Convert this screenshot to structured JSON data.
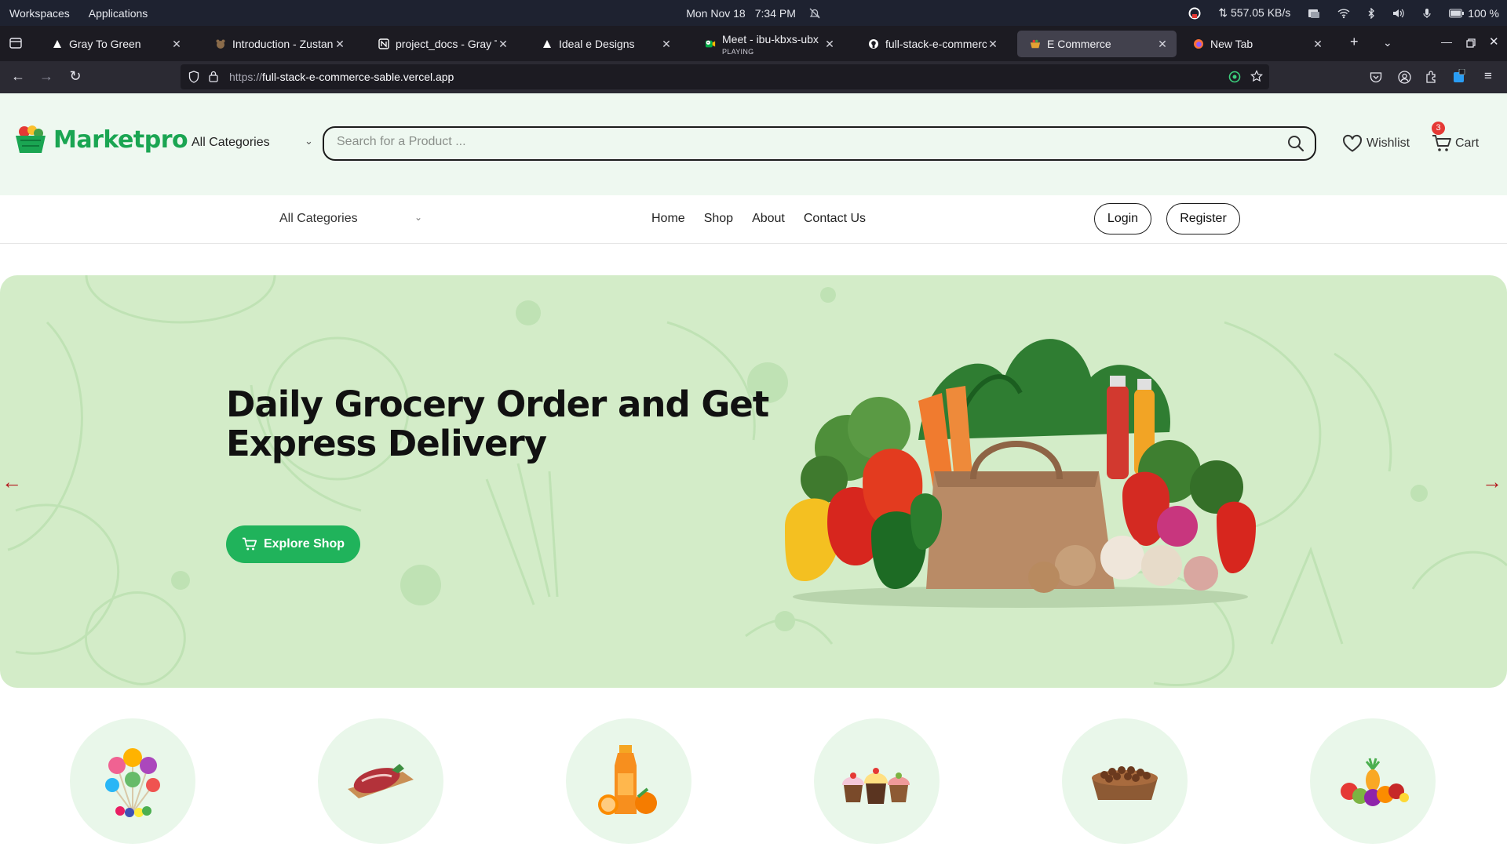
{
  "os": {
    "workspaces": "Workspaces",
    "applications": "Applications",
    "date": "Mon Nov 18",
    "time": "7:34 PM",
    "net_speed": "⇅ 557.05 KB/s",
    "battery": "100 %"
  },
  "tabs": [
    {
      "title": "Gray To Green",
      "icon": "triangle-logo-icon"
    },
    {
      "title": "Introduction - Zustand",
      "icon": "bear-icon"
    },
    {
      "title": "project_docs - Gray To",
      "icon": "notion-icon"
    },
    {
      "title": "Ideal e Designs",
      "icon": "triangle-logo-icon"
    },
    {
      "title": "Meet - ibu-kbxs-ubx",
      "subtitle": "PLAYING",
      "icon": "meet-icon"
    },
    {
      "title": "full-stack-e-commerce",
      "icon": "github-icon"
    },
    {
      "title": "E Commerce",
      "icon": "basket-icon",
      "active": true
    },
    {
      "title": "New Tab",
      "icon": "firefox-icon"
    }
  ],
  "browser": {
    "url_scheme": "https://",
    "url_host": "full-stack-e-commerce-sable.vercel.app"
  },
  "header": {
    "logo_text": "Marketpro",
    "category_label": "All Categories",
    "search_placeholder": "Search for a Product ...",
    "wishlist_label": "Wishlist",
    "cart_label": "Cart",
    "cart_count": "3"
  },
  "subnav": {
    "category_label": "All Categories",
    "menu": [
      "Home",
      "Shop",
      "About",
      "Contact Us"
    ],
    "login_label": "Login",
    "register_label": "Register"
  },
  "hero": {
    "headline": "Daily Grocery Order and Get Express Delivery",
    "cta_label": "Explore Shop",
    "bg_color": "#d3ecc8",
    "accent_color": "#20b35b"
  },
  "categories": [
    {
      "icon": "lollipop-icon"
    },
    {
      "icon": "meat-icon"
    },
    {
      "icon": "juice-icon"
    },
    {
      "icon": "cupcake-icon"
    },
    {
      "icon": "pet-food-icon"
    },
    {
      "icon": "fruits-icon"
    }
  ]
}
